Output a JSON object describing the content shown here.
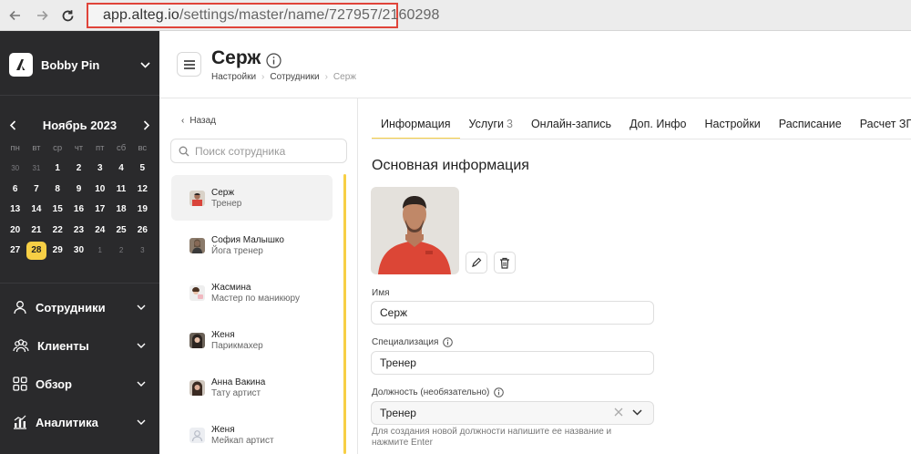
{
  "browser": {
    "url_main": "app.alteg.io",
    "url_path": "/settings/master/name/727957/2160298"
  },
  "sidebar": {
    "brand": "Bobby Pin",
    "calendar": {
      "month_title": "Ноябрь 2023",
      "weekdays": [
        "пн",
        "вт",
        "ср",
        "чт",
        "пт",
        "сб",
        "вс"
      ],
      "weeks": [
        [
          {
            "d": "30",
            "out": true
          },
          {
            "d": "31",
            "out": true
          },
          {
            "d": "1"
          },
          {
            "d": "2"
          },
          {
            "d": "3"
          },
          {
            "d": "4"
          },
          {
            "d": "5"
          }
        ],
        [
          {
            "d": "6"
          },
          {
            "d": "7"
          },
          {
            "d": "8"
          },
          {
            "d": "9"
          },
          {
            "d": "10"
          },
          {
            "d": "11"
          },
          {
            "d": "12"
          }
        ],
        [
          {
            "d": "13"
          },
          {
            "d": "14"
          },
          {
            "d": "15"
          },
          {
            "d": "16"
          },
          {
            "d": "17"
          },
          {
            "d": "18"
          },
          {
            "d": "19"
          }
        ],
        [
          {
            "d": "20"
          },
          {
            "d": "21"
          },
          {
            "d": "22"
          },
          {
            "d": "23"
          },
          {
            "d": "24"
          },
          {
            "d": "25"
          },
          {
            "d": "26"
          }
        ],
        [
          {
            "d": "27"
          },
          {
            "d": "28",
            "selected": true
          },
          {
            "d": "29"
          },
          {
            "d": "30"
          },
          {
            "d": "1",
            "out": true
          },
          {
            "d": "2",
            "out": true
          },
          {
            "d": "3",
            "out": true
          }
        ]
      ]
    },
    "menu": [
      {
        "label": "Сотрудники",
        "icon": "user-icon"
      },
      {
        "label": "Клиенты",
        "icon": "users-icon"
      },
      {
        "label": "Обзор",
        "icon": "grid-icon"
      },
      {
        "label": "Аналитика",
        "icon": "analytics-icon"
      }
    ]
  },
  "header": {
    "title": "Серж",
    "breadcrumb": [
      "Настройки",
      "Сотрудники",
      "Серж"
    ]
  },
  "staff_list": {
    "back_label": "Назад",
    "search_placeholder": "Поиск сотрудника",
    "items": [
      {
        "name": "Серж",
        "role": "Тренер",
        "active": true
      },
      {
        "name": "София Малышко",
        "role": "Йога тренер"
      },
      {
        "name": "Жасмина",
        "role": "Мастер по маникюру"
      },
      {
        "name": "Женя",
        "role": "Парикмахер"
      },
      {
        "name": "Анна Вакина",
        "role": "Тату артист"
      },
      {
        "name": "Женя",
        "role": "Мейкап артист"
      }
    ]
  },
  "tabs": [
    {
      "label": "Информация",
      "active": true
    },
    {
      "label": "Услуги",
      "badge": "3"
    },
    {
      "label": "Онлайн-запись"
    },
    {
      "label": "Доп. Инфо"
    },
    {
      "label": "Настройки"
    },
    {
      "label": "Расписание"
    },
    {
      "label": "Расчет ЗП"
    }
  ],
  "form": {
    "section_title": "Основная информация",
    "name_label": "Имя",
    "name_value": "Серж",
    "spec_label": "Специализация",
    "spec_value": "Тренер",
    "position_label": "Должность (необязательно)",
    "position_value": "Тренер",
    "position_hint": "Для создания новой должности напишите ее название и нажмите Enter"
  },
  "colors": {
    "accent": "#f7cf45",
    "sidebar_bg": "#2a2a2c",
    "url_highlight": "#e0443a"
  }
}
